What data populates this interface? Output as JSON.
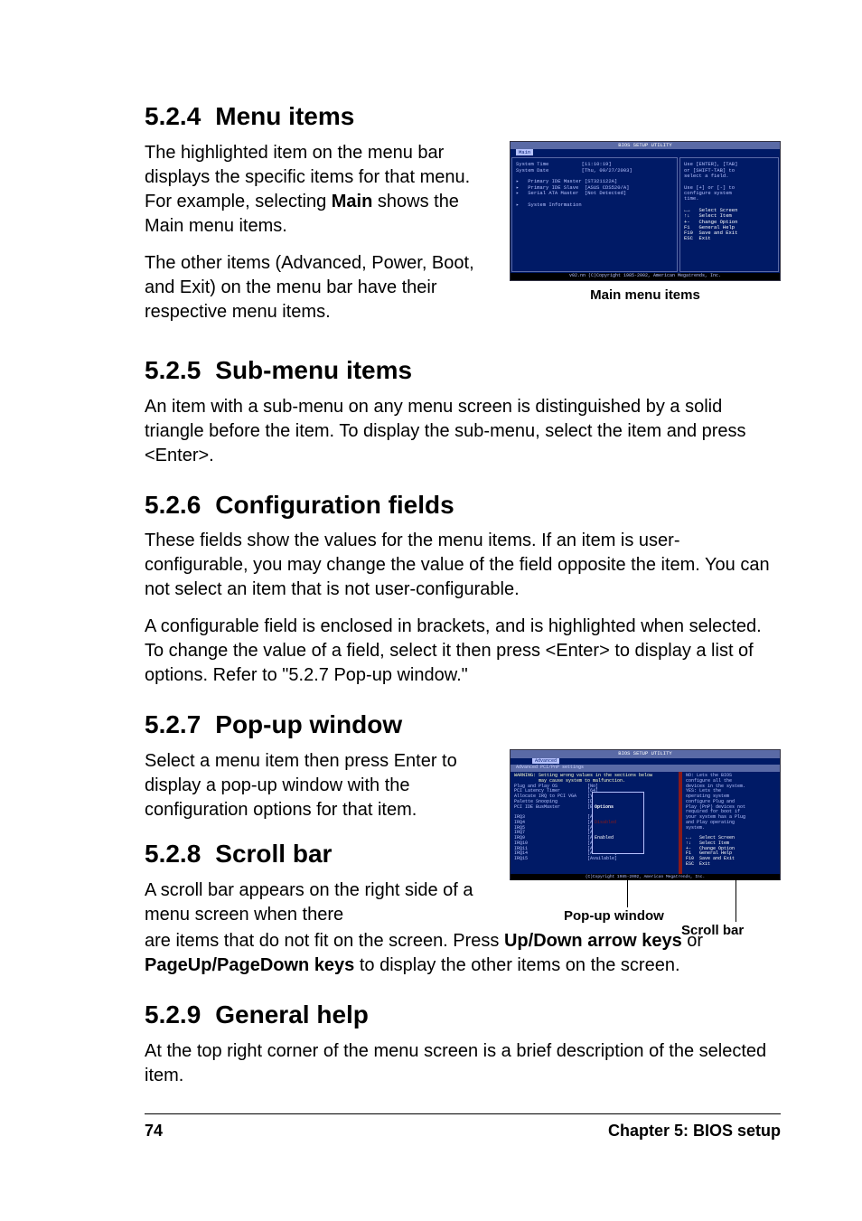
{
  "sections": {
    "s524": {
      "num": "5.2.4",
      "title": "Menu items"
    },
    "s525": {
      "num": "5.2.5",
      "title": "Sub-menu items"
    },
    "s526": {
      "num": "5.2.6",
      "title": "Configuration fields"
    },
    "s527": {
      "num": "5.2.7",
      "title": "Pop-up window"
    },
    "s528": {
      "num": "5.2.8",
      "title": "Scroll bar"
    },
    "s529": {
      "num": "5.2.9",
      "title": "General help"
    }
  },
  "para": {
    "p524a_pre": "The highlighted item on the menu bar displays the specific items for that menu. For example, selecting ",
    "p524a_bold": "Main",
    "p524a_post": " shows the Main menu items.",
    "p524b": "The other items (Advanced, Power, Boot, and Exit) on the menu bar have their respective menu items.",
    "p525": "An item with a sub-menu on any menu screen is distinguished by a solid triangle before the item. To display the sub-menu, select the item and press <Enter>.",
    "p526a": "These fields show the values for the menu items. If an item is user-configurable, you may change the value of the field opposite the item. You can not select an item that is not user-configurable.",
    "p526b": "A configurable field is enclosed in brackets, and is highlighted when selected. To change the value of a field, select it then press <Enter> to display a list of options. Refer to \"5.2.7 Pop-up window.\"",
    "p527": "Select a menu item then press Enter to display a pop-up window with the configuration options for that item.",
    "p528a": "A scroll bar appears on the right side of a menu screen when there",
    "p528b_pre": "are items that do not fit on the screen. Press ",
    "p528b_b1": "Up/Down arrow keys",
    "p528b_mid": " or ",
    "p528b_b2": "PageUp/PageDown keys",
    "p528b_post": " to display the other items on the screen.",
    "p529": "At the top right corner of the menu screen is a brief description of the selected item."
  },
  "fig1": {
    "caption": "Main menu items",
    "bios_title": "BIOS SETUP UTILITY",
    "tab_main": "Main",
    "left_text": "System Time           [11:10:19]\nSystem Date           [Thu, 09/27/2003]\n\n▸   Primary IDE Master [ST321122A]\n▸   Primary IDE Slave  [ASUS CDS520/A]\n▸   Serial ATA Master  [Not Detected]\n\n▸   System Information",
    "right_text": "Use [ENTER], [TAB]\nor [SHIFT-TAB] to\nselect a field.\n\nUse [+] or [-] to\nconfigure system\ntime.",
    "right_keys": "←→   Select Screen\n↑↓   Select Item\n+-   Change Option\nF1   General Help\nF10  Save and Exit\nESC  Exit",
    "footer": "v02.nn (C)Copyright 1985-2002, American Megatrends, Inc."
  },
  "fig2": {
    "caption_popup": "Pop-up window",
    "caption_scroll": "Scroll bar",
    "bios_title": "BIOS SETUP UTILITY",
    "tab_adv": "Advanced",
    "subtitle": "Advanced PCI/PnP settings",
    "warn": "WARNING: Setting wrong values in the sections below\n         may cause system to malfunction.",
    "left_text": "Plug and Play OS           [No]\nPCI Latency Timer          [64]\nAllocate IRQ to PCI VGA    [Yes]\nPalette Snooping           [Disabled]\nPCI IDE BusMaster          [Enabled]\n\nIRQ3                       [Available]\nIRQ4                       [Available]\nIRQ5                       [Available]\nIRQ7                       [Available]\nIRQ9                       [Available]\nIRQ10                      [Available]\nIRQ11                      [Available]\nIRQ14                      [Available]\nIRQ15                      [Available]",
    "popup_title": "Options",
    "popup_items": "Disabled\nEnabled",
    "right_text": "NO: Lets the BIOS\nconfigure all the\ndevices in the system.\nYES: Lets the\noperating system\nconfigure Plug and\nPlay (PnP) devices not\nrequired for boot if\nyour system has a Plug\nand Play operating\nsystem.",
    "right_keys": "←→   Select Screen\n↑↓   Select Item\n+-   Change Option\nF1   General Help\nF10  Save and Exit\nESC  Exit",
    "footer": "(C)Copyright 1985-2002, American Megatrends, Inc."
  },
  "footer": {
    "page": "74",
    "chapter": "Chapter 5: BIOS setup"
  }
}
